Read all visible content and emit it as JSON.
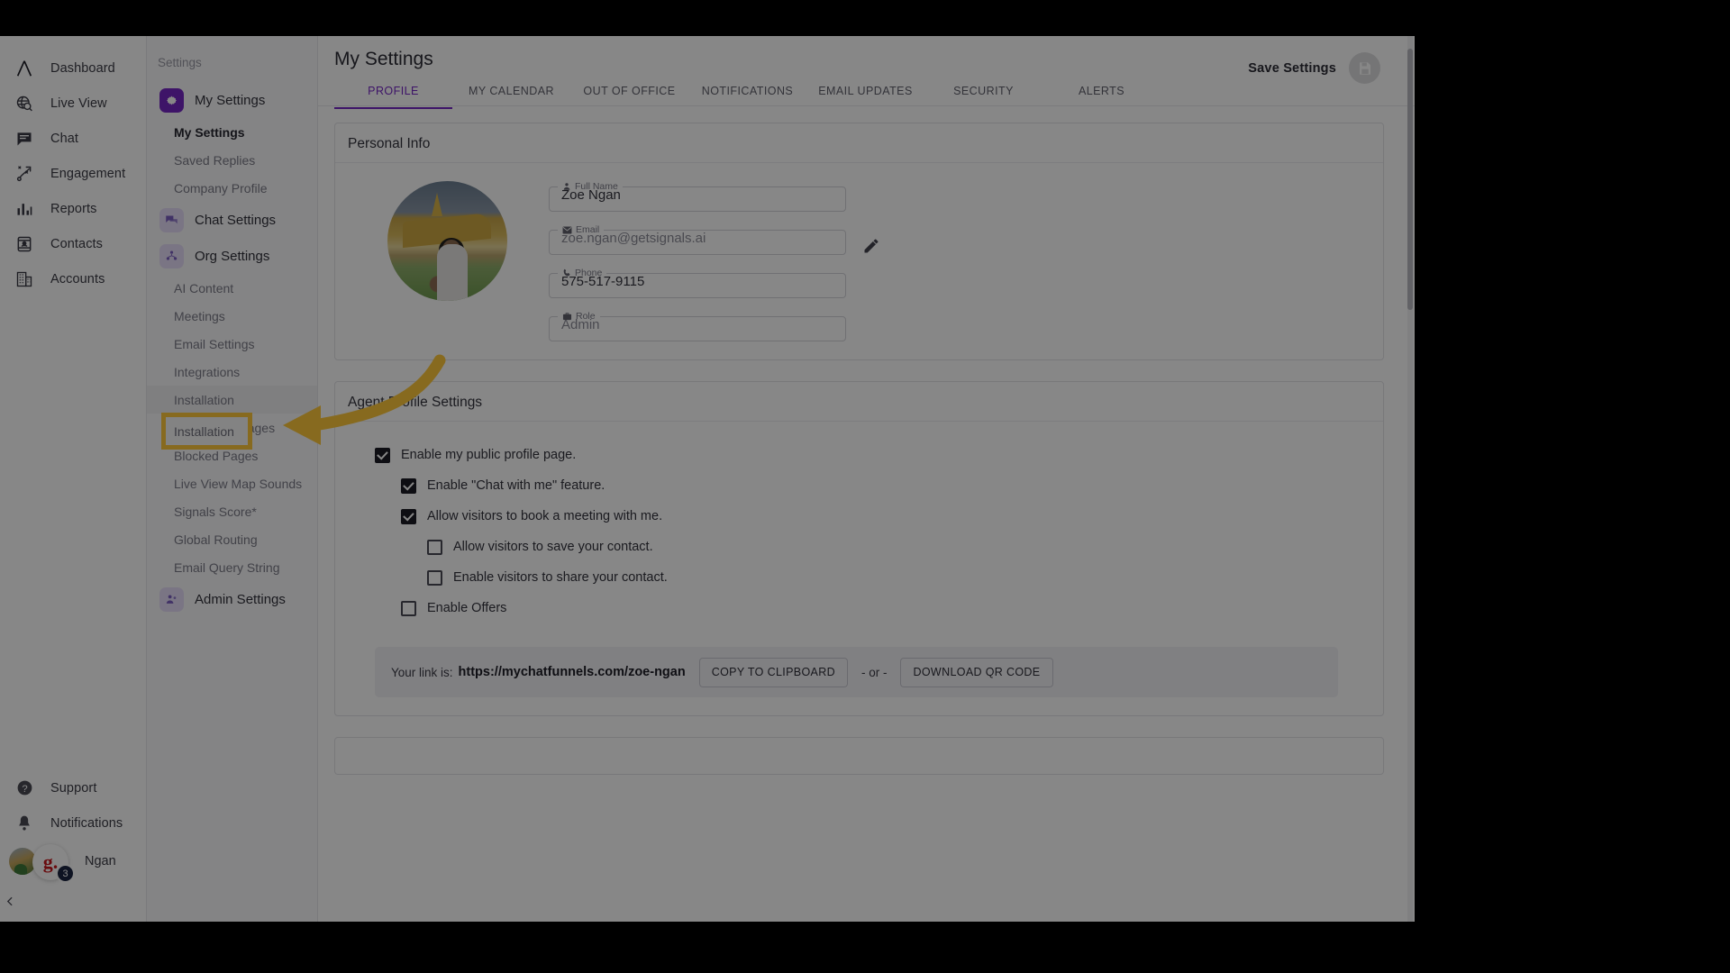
{
  "nav": {
    "items": [
      {
        "label": "Dashboard",
        "icon": "logo-chevron-icon"
      },
      {
        "label": "Live View",
        "icon": "globe-search-icon"
      },
      {
        "label": "Chat",
        "icon": "chat-bubble-icon"
      },
      {
        "label": "Engagement",
        "icon": "engagement-path-icon"
      },
      {
        "label": "Reports",
        "icon": "bar-chart-icon"
      },
      {
        "label": "Contacts",
        "icon": "contact-card-icon"
      },
      {
        "label": "Accounts",
        "icon": "building-icon"
      }
    ],
    "bottom": [
      {
        "label": "Support",
        "icon": "help-circle-icon"
      },
      {
        "label": "Notifications",
        "icon": "bell-icon"
      }
    ],
    "user": {
      "name": "Ngan",
      "badge_letter": "g.",
      "badge_count": "3"
    }
  },
  "settings_nav": {
    "title": "Settings",
    "groups": [
      {
        "label": "My Settings",
        "icon": "gear-icon",
        "state": "active",
        "children": [
          {
            "label": "My Settings",
            "current": true
          },
          {
            "label": "Saved Replies",
            "current": false
          },
          {
            "label": "Company Profile",
            "current": false
          }
        ]
      },
      {
        "label": "Chat Settings",
        "icon": "chat-settings-icon",
        "state": "soft",
        "children": []
      },
      {
        "label": "Org Settings",
        "icon": "org-people-icon",
        "state": "soft",
        "children": [
          {
            "label": "AI Content",
            "current": false
          },
          {
            "label": "Meetings",
            "current": false
          },
          {
            "label": "Email Settings",
            "current": false
          },
          {
            "label": "Integrations",
            "current": false
          },
          {
            "label": "Installation",
            "current": false,
            "highlighted": true
          },
          {
            "label": "High-Intent Pages",
            "current": false
          },
          {
            "label": "Blocked Pages",
            "current": false
          },
          {
            "label": "Live View Map Sounds",
            "current": false
          },
          {
            "label": "Signals Score*",
            "current": false
          },
          {
            "label": "Global Routing",
            "current": false
          },
          {
            "label": "Email Query String",
            "current": false
          }
        ]
      },
      {
        "label": "Admin Settings",
        "icon": "admin-people-icon",
        "state": "soft",
        "children": []
      }
    ]
  },
  "header": {
    "title": "My Settings",
    "save_label": "Save Settings",
    "save_icon": "save-disk-icon",
    "tabs": [
      {
        "label": "PROFILE",
        "active": true
      },
      {
        "label": "MY CALENDAR",
        "active": false
      },
      {
        "label": "OUT OF OFFICE",
        "active": false
      },
      {
        "label": "NOTIFICATIONS",
        "active": false
      },
      {
        "label": "EMAIL UPDATES",
        "active": false
      },
      {
        "label": "SECURITY",
        "active": false
      },
      {
        "label": "ALERTS",
        "active": false
      }
    ]
  },
  "personal_info": {
    "title": "Personal Info",
    "avatar_alt": "profile-photo",
    "edit_icon": "pencil-icon",
    "fields": [
      {
        "label": "Full Name",
        "value": "Zoe Ngan",
        "icon": "person-icon",
        "muted": false
      },
      {
        "label": "Email",
        "value": "zoe.ngan@getsignals.ai",
        "icon": "envelope-icon",
        "muted": true
      },
      {
        "label": "Phone",
        "value": "575-517-9115",
        "icon": "phone-icon",
        "muted": false
      },
      {
        "label": "Role",
        "value": "Admin",
        "icon": "briefcase-icon",
        "muted": true
      }
    ]
  },
  "agent_profile": {
    "title": "Agent Profile Settings",
    "checkboxes": [
      {
        "label": "Enable my public profile page.",
        "checked": true,
        "indent": 0
      },
      {
        "label": "Enable \"Chat with me\" feature.",
        "checked": true,
        "indent": 1
      },
      {
        "label": "Allow visitors to book a meeting with me.",
        "checked": true,
        "indent": 1
      },
      {
        "label": "Allow visitors to save your contact.",
        "checked": false,
        "indent": 2
      },
      {
        "label": "Enable visitors to share your contact.",
        "checked": false,
        "indent": 2
      },
      {
        "label": "Enable Offers",
        "checked": false,
        "indent": 1
      }
    ],
    "link_bar": {
      "lead": "Your link is:",
      "url": "https://mychatfunnels.com/zoe-ngan",
      "copy_button": "COPY TO CLIPBOARD",
      "separator": "- or -",
      "qr_button": "DOWNLOAD QR CODE"
    }
  },
  "annotation": {
    "highlight_target": "Installation",
    "highlight_color": "#ffc93c",
    "arrow_color": "#ffc93c"
  }
}
